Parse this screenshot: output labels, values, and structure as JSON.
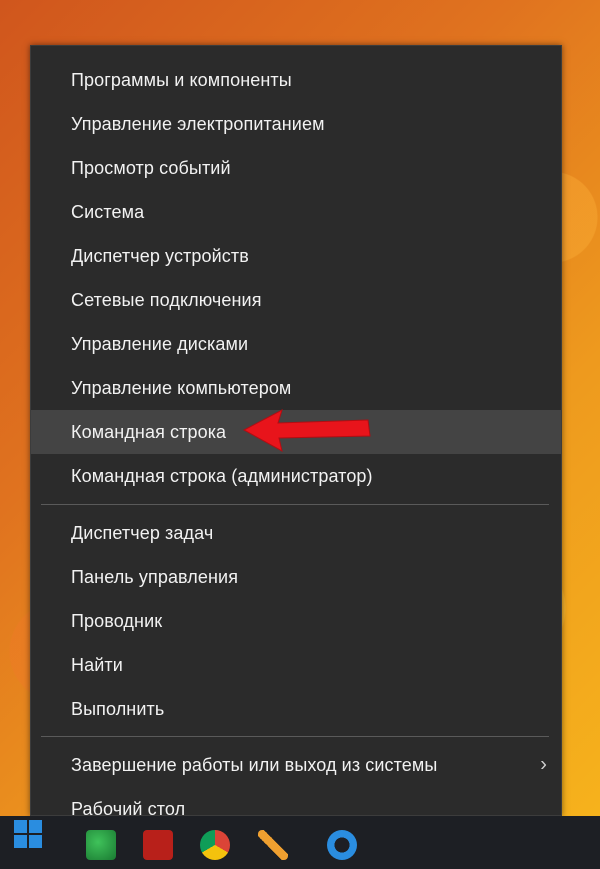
{
  "context_menu": {
    "items_group1": [
      {
        "label": "Программы и компоненты"
      },
      {
        "label": "Управление электропитанием"
      },
      {
        "label": "Просмотр событий"
      },
      {
        "label": "Система"
      },
      {
        "label": "Диспетчер устройств"
      },
      {
        "label": "Сетевые подключения"
      },
      {
        "label": "Управление дисками"
      },
      {
        "label": "Управление компьютером"
      },
      {
        "label": "Командная строка",
        "highlighted": true
      },
      {
        "label": "Командная строка (администратор)"
      }
    ],
    "items_group2": [
      {
        "label": "Диспетчер задач"
      },
      {
        "label": "Панель управления"
      },
      {
        "label": "Проводник"
      },
      {
        "label": "Найти"
      },
      {
        "label": "Выполнить"
      }
    ],
    "items_group3": [
      {
        "label": "Завершение работы или выход из системы",
        "has_submenu": true
      },
      {
        "label": "Рабочий стол"
      }
    ]
  },
  "annotation": {
    "arrow_color": "#e8141b",
    "points_to": "Командная строка"
  },
  "taskbar": {
    "icons": [
      "windows-start-icon",
      "phone-icon",
      "filezilla-icon",
      "chrome-icon",
      "pencil-icon",
      "edge-icon"
    ]
  }
}
